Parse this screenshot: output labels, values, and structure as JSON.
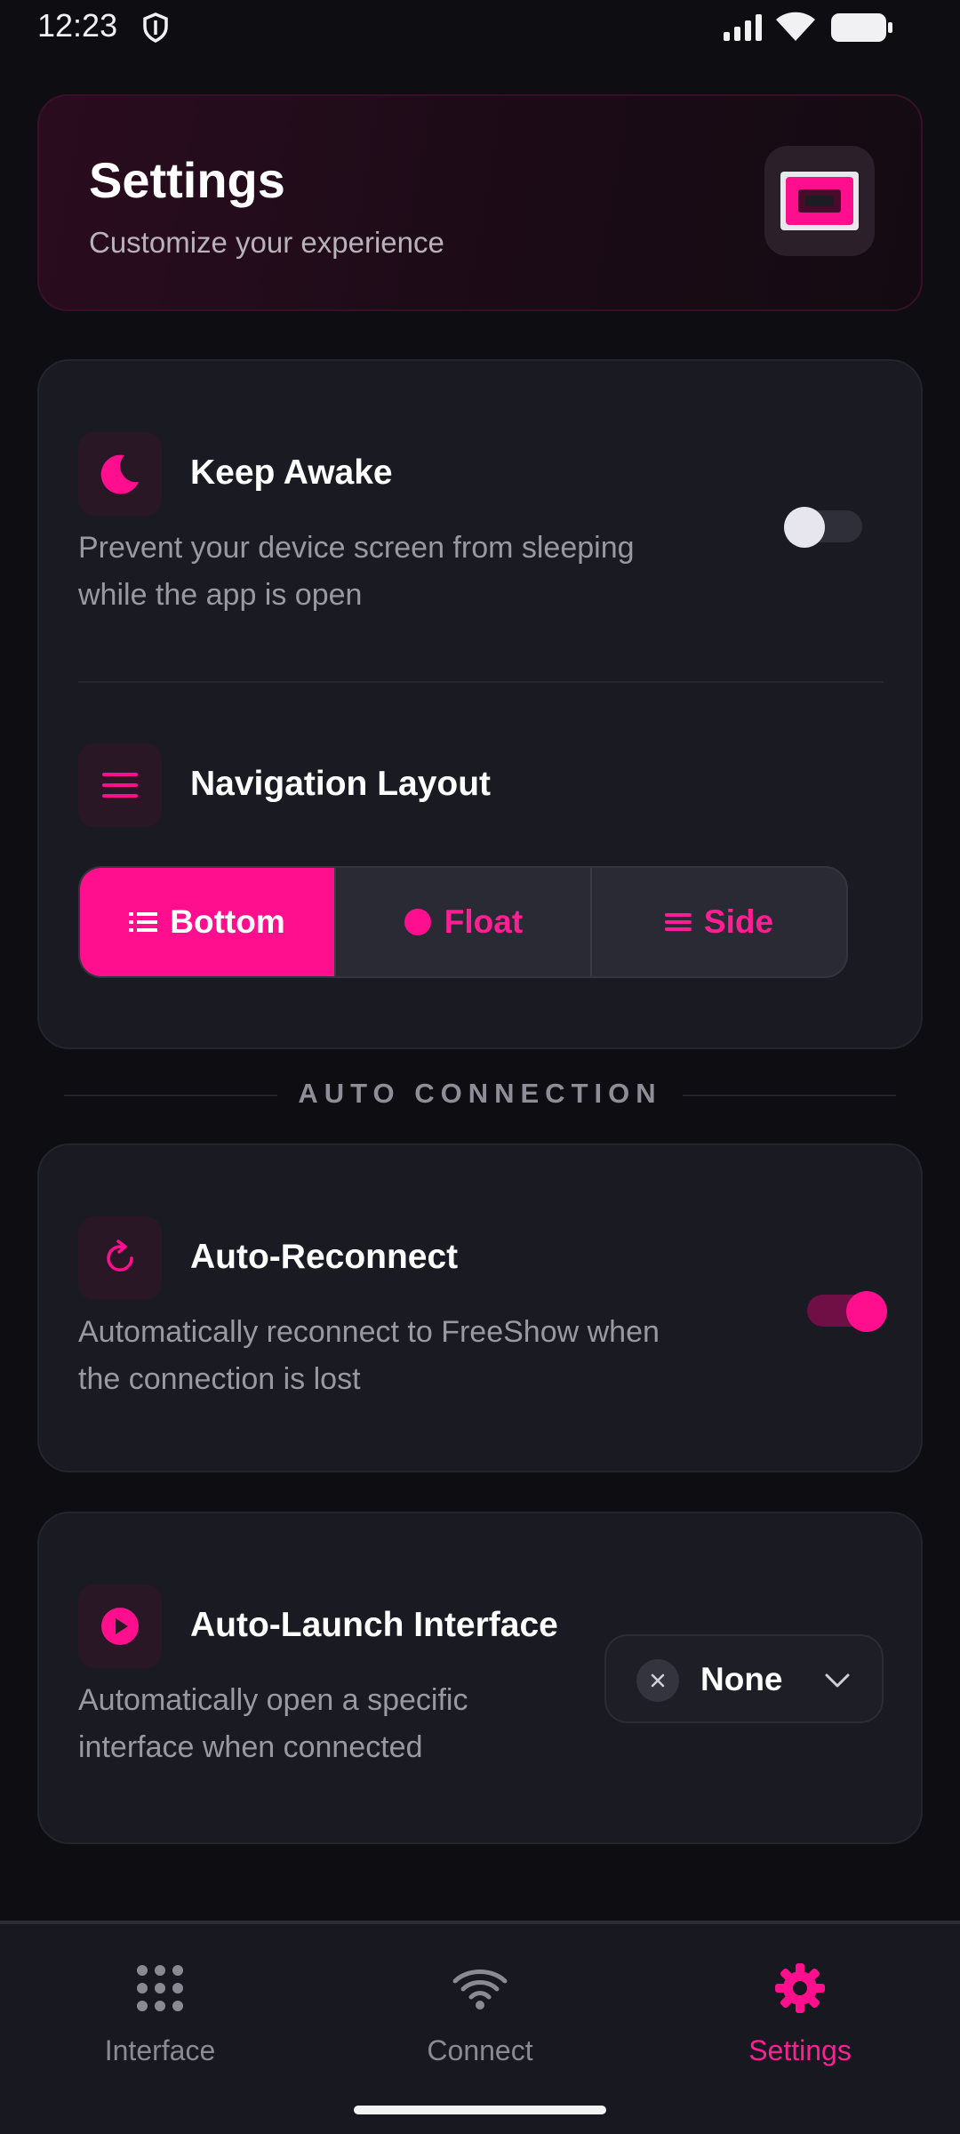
{
  "status_bar": {
    "time": "12:23"
  },
  "header": {
    "title": "Settings",
    "subtitle": "Customize your experience"
  },
  "keep_awake": {
    "title": "Keep Awake",
    "description_line1": "Prevent your device screen from sleeping",
    "description_line2": "while the app is open",
    "enabled": false,
    "icon": "moon-icon"
  },
  "navigation_layout": {
    "title": "Navigation Layout",
    "icon": "menu-icon",
    "options": [
      {
        "label": "Bottom",
        "icon": "list-icon",
        "selected": true
      },
      {
        "label": "Float",
        "icon": "dot-icon",
        "selected": false
      },
      {
        "label": "Side",
        "icon": "lines-icon",
        "selected": false
      }
    ]
  },
  "auto_connection": {
    "section_title": "AUTO CONNECTION",
    "auto_reconnect": {
      "title": "Auto-Reconnect",
      "description_line1": "Automatically reconnect to FreeShow when",
      "description_line2": "the connection is lost",
      "enabled": true,
      "icon": "refresh-icon"
    },
    "auto_launch": {
      "title": "Auto-Launch Interface",
      "description_line1": "Automatically open a specific",
      "description_line2": "interface when connected",
      "selected": "None",
      "icon": "play-icon"
    }
  },
  "bottom_nav": {
    "items": [
      {
        "label": "Interface",
        "icon": "grid-icon",
        "active": false
      },
      {
        "label": "Connect",
        "icon": "wifi-icon",
        "active": false
      },
      {
        "label": "Settings",
        "icon": "gear-icon",
        "active": true
      }
    ]
  },
  "colors": {
    "accent": "#ff0f8e",
    "background": "#0d0d12",
    "card": "#1a1a22",
    "muted_text": "#9a98a2"
  }
}
